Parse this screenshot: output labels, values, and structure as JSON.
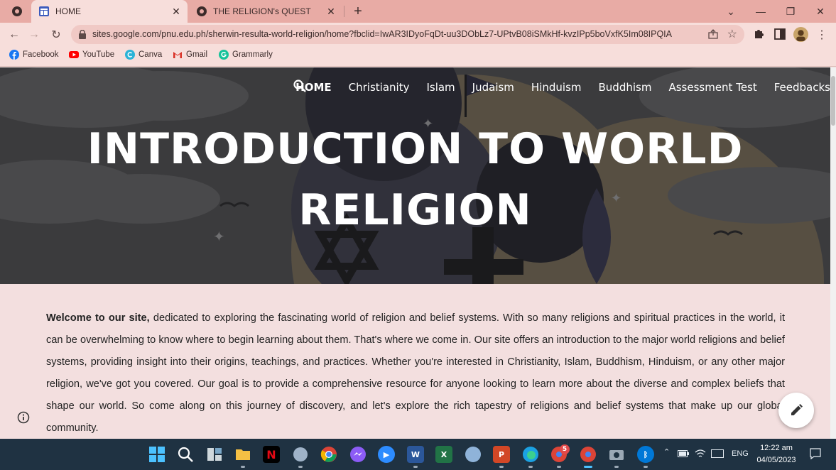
{
  "browser": {
    "tabs": [
      {
        "title": "HOME",
        "active": true,
        "favicon": "google-sites-icon"
      },
      {
        "title": "THE RELIGION's QUEST",
        "active": false,
        "favicon": "chrome-icon"
      }
    ],
    "url": "sites.google.com/pnu.edu.ph/sherwin-resulta-world-religion/home?fbclid=IwAR3IDyoFqDt-uu3DObLz7-UPtvB08iSMkHf-kvzIPp5boVxfK5Im08IPQIA",
    "bookmarks": [
      {
        "label": "Facebook",
        "icon": "facebook-icon"
      },
      {
        "label": "YouTube",
        "icon": "youtube-icon"
      },
      {
        "label": "Canva",
        "icon": "canva-icon"
      },
      {
        "label": "Gmail",
        "icon": "gmail-icon"
      },
      {
        "label": "Grammarly",
        "icon": "grammarly-icon"
      }
    ]
  },
  "site": {
    "nav": [
      {
        "label": "HOME",
        "current": true
      },
      {
        "label": "Christianity"
      },
      {
        "label": "Islam"
      },
      {
        "label": "Judaism"
      },
      {
        "label": "Hinduism"
      },
      {
        "label": "Buddhism"
      },
      {
        "label": "Assessment Test"
      },
      {
        "label": "Feedbacks"
      }
    ],
    "hero_title_line1": "INTRODUCTION TO WORLD",
    "hero_title_line2": "RELIGION",
    "intro_bold": "Welcome to our site,",
    "intro_text": " dedicated to exploring the fascinating world of religion and belief systems. With so many religions and spiritual practices in the world, it can be overwhelming to know where to begin learning about them. That's where we come in. Our site offers an introduction to the major world religions and belief systems, providing insight into their origins, teachings, and practices. Whether you're interested in Christianity, Islam, Buddhism, Hinduism, or any other major religion, we've got you covered. Our goal is to provide a comprehensive resource for anyone looking to learn more about the diverse and complex beliefs that shape our world. So come along on this journey of discovery, and let's explore the rich tapestry of religions and belief systems that make up our global community."
  },
  "taskbar": {
    "tray_lang": "ENG",
    "time": "12:22 am",
    "date": "04/05/2023",
    "messenger_badge": "5"
  },
  "colors": {
    "tabstrip": "#e8aba5",
    "toolbar": "#f7dedb",
    "page_bg": "#f3dfdf",
    "taskbar": "#1f3242"
  }
}
